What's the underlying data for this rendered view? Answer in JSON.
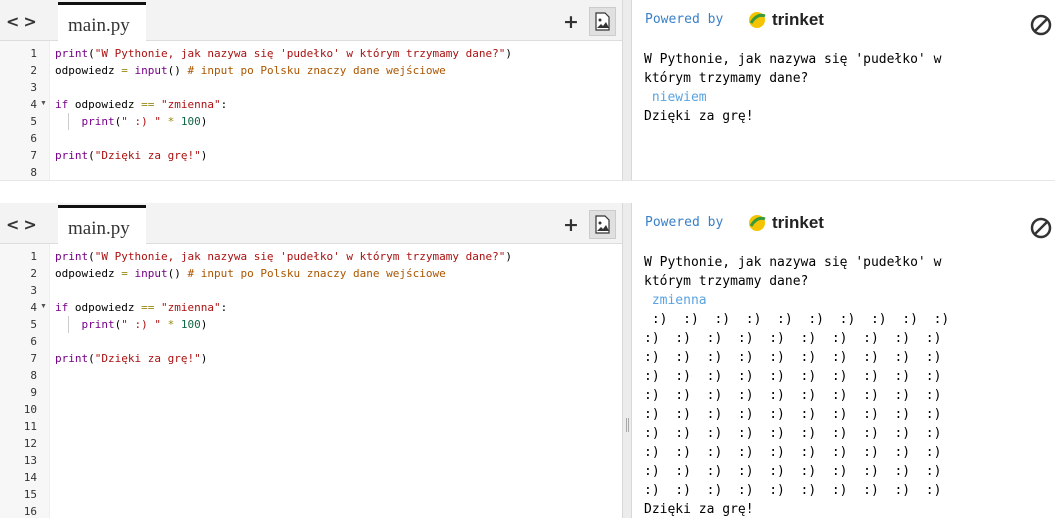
{
  "file_tab": "main.py",
  "code_lines": [
    "print(\"W Pythonie, jak nazywa się 'pudełko' w którym trzymamy dane?\")",
    "odpowiedz = input() # input po Polsku znaczy dane wejściowe",
    "",
    "if odpowiedz == \"zmienna\":",
    "    print(\" :) \" * 100)",
    "",
    "print(\"Dzięki za grę!\")"
  ],
  "panel1": {
    "line_numbers": [
      "1",
      "2",
      "3",
      "4",
      "5",
      "6",
      "7",
      "8"
    ],
    "output": {
      "prompt_line1": "W Pythonie, jak nazywa się 'pudełko' w",
      "prompt_line2": "którym trzymamy dane?",
      "user_input": " niewiem",
      "final": "Dzięki za grę!"
    }
  },
  "panel2": {
    "line_numbers": [
      "1",
      "2",
      "3",
      "4",
      "5",
      "6",
      "7",
      "8",
      "9",
      "10",
      "11",
      "12",
      "13",
      "14",
      "15",
      "16"
    ],
    "output": {
      "prompt_line1": "W Pythonie, jak nazywa się 'pudełko' w",
      "prompt_line2": "którym trzymamy dane?",
      "user_input": " zmienna",
      "smiley_first": " :)  :)  :)  :)  :)  :)  :)  :)  :)  :)",
      "smiley_row": ":)  :)  :)  :)  :)  :)  :)  :)  :)  :)",
      "final": "Dzięki za grę!"
    }
  },
  "console": {
    "powered_by": "Powered by",
    "brand": "trinket"
  },
  "icons": {
    "nav": "chevron-left-right-icon",
    "add": "plus-icon",
    "image": "image-icon",
    "stop": "stop-icon",
    "logo": "trinket-logo-icon"
  },
  "colors": {
    "keyword": "#770088",
    "string": "#aa1111",
    "number": "#116644",
    "comment": "#aa5500",
    "powered": "#3a80c7",
    "user_input": "#5aa3e0"
  }
}
